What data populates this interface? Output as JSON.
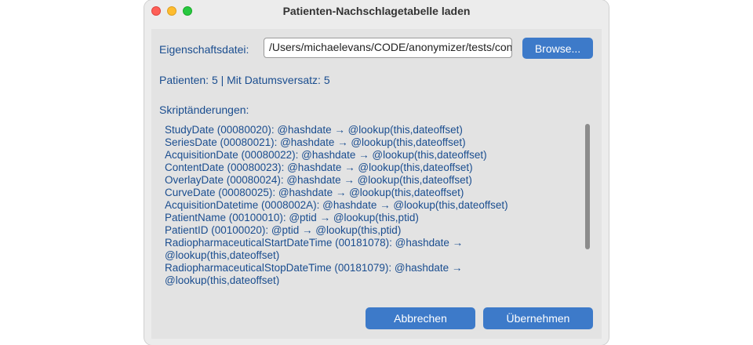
{
  "window": {
    "title": "Patienten-Nachschlagetabelle laden"
  },
  "form": {
    "property_file_label": "Eigenschaftsdatei:",
    "property_file_value": "/Users/michaelevans/CODE/anonymizer/tests/contr",
    "browse_label": "Browse...",
    "summary": "Patienten: 5  |  Mit Datumsversatz: 5",
    "script_changes_label": "Skriptänderungen:"
  },
  "script_changes": [
    "StudyDate (00080020): @hashdate → @lookup(this,dateoffset)",
    "SeriesDate (00080021): @hashdate → @lookup(this,dateoffset)",
    "AcquisitionDate (00080022): @hashdate → @lookup(this,dateoffset)",
    "ContentDate (00080023): @hashdate → @lookup(this,dateoffset)",
    "OverlayDate (00080024): @hashdate → @lookup(this,dateoffset)",
    "CurveDate (00080025): @hashdate → @lookup(this,dateoffset)",
    "AcquisitionDatetime (0008002A): @hashdate → @lookup(this,dateoffset)",
    "PatientName (00100010): @ptid → @lookup(this,ptid)",
    "PatientID (00100020): @ptid → @lookup(this,ptid)",
    "RadiopharmaceuticalStartDateTime (00181078): @hashdate →",
    "@lookup(this,dateoffset)",
    "RadiopharmaceuticalStopDateTime (00181079): @hashdate →",
    "@lookup(this,dateoffset)"
  ],
  "buttons": {
    "cancel_label": "Abbrechen",
    "apply_label": "Übernehmen"
  },
  "colors": {
    "accent": "#3d7ac9",
    "text_blue": "#1a4d8f",
    "close": "#fe5f57",
    "minimize": "#febc2e",
    "maximize": "#28c840"
  }
}
